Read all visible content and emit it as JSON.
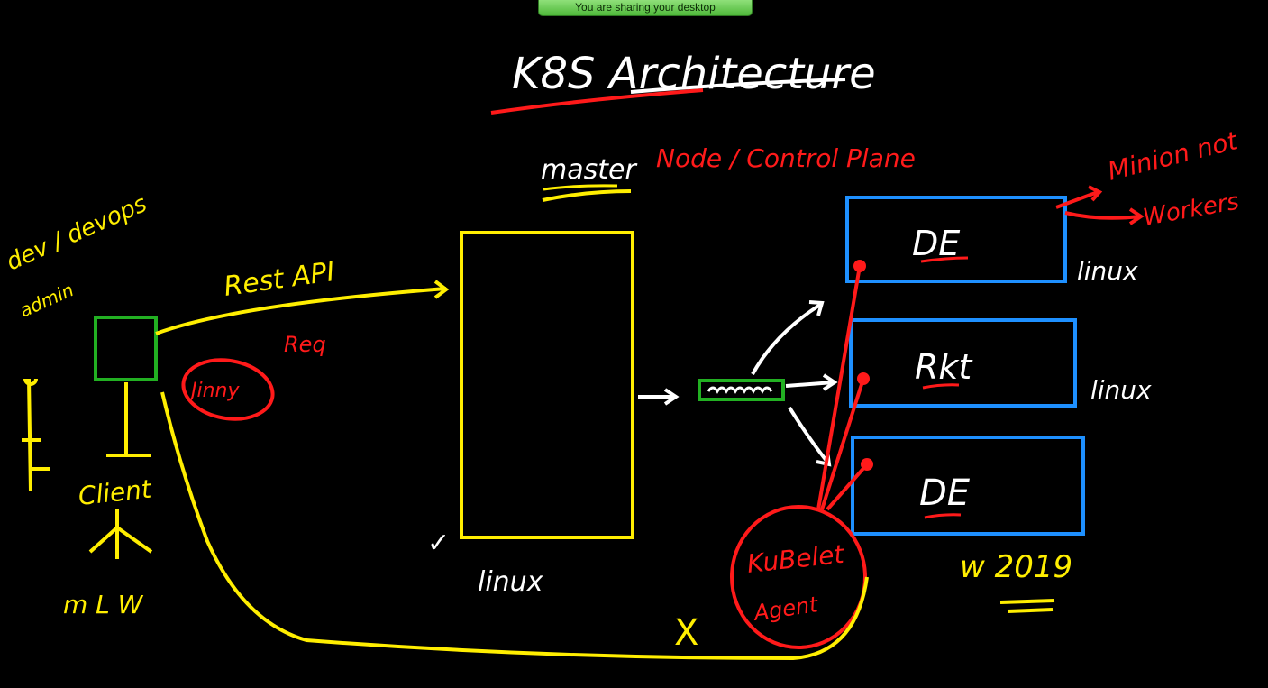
{
  "banner": {
    "label": "You are sharing your desktop"
  },
  "title": "K8S Architecture",
  "master": {
    "label": "master",
    "subtitle": "Node / Control Plane",
    "os": "linux"
  },
  "client": {
    "role_line1": "dev / devops",
    "role_line2": "admin",
    "label": "Client",
    "os_options": "m  L  W"
  },
  "rest_api": {
    "label": "Rest API",
    "req": "Req",
    "jinny": "Jinny"
  },
  "nodes": [
    {
      "name": "DE",
      "os": "linux"
    },
    {
      "name": "Rkt",
      "os": "linux"
    },
    {
      "name": "DE",
      "os": ""
    }
  ],
  "windows": {
    "label": "w 2019"
  },
  "workers": {
    "line1": "Minion not",
    "line2": "Workers"
  },
  "kubelet": {
    "line1": "KuBelet",
    "line2": "Agent"
  },
  "marks": {
    "check": "✓",
    "cross": "X"
  },
  "colors": {
    "yellow": "#ffee00",
    "red": "#ff1a1a",
    "blue": "#1e90ff",
    "green": "#22b022",
    "white": "#ffffff"
  }
}
